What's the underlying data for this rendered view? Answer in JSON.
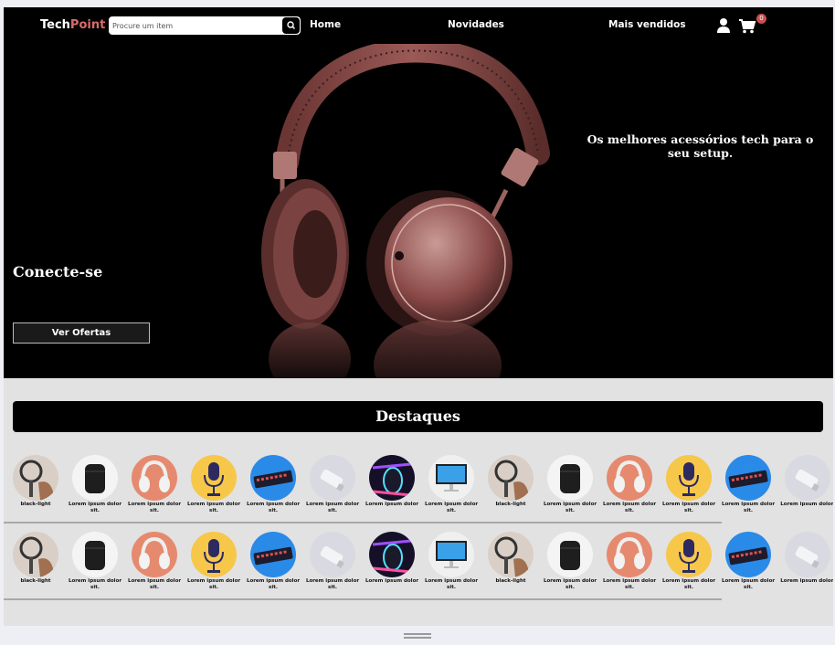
{
  "nav": {
    "logo_main": "Tech",
    "logo_accent": "Point",
    "search_placeholder": "Procure um item",
    "links": [
      "Home",
      "Novidades",
      "Mais vendidos"
    ],
    "cart_count": "0"
  },
  "hero": {
    "title": "Conecte-se",
    "tagline": "Os melhores acessórios tech para o seu setup.",
    "button": "Ver Ofertas"
  },
  "section": {
    "title": "Destaques"
  },
  "row1": [
    {
      "icon": "ring-light-icon",
      "caption": "black-light"
    },
    {
      "icon": "earbuds-case-icon",
      "caption": "Lorem ipsum dolor sit."
    },
    {
      "icon": "headphones-icon",
      "caption": "Lorem ipsum dolor sit."
    },
    {
      "icon": "microphone-icon",
      "caption": "Lorem ipsum dolor sit."
    },
    {
      "icon": "keyboard-icon",
      "caption": "Lorem ipsum dolor sit."
    },
    {
      "icon": "usb-drive-icon",
      "caption": "Lorem ipsum dolor sit."
    },
    {
      "icon": "mouse-rgb-icon",
      "caption": "Lorem ipsum dolor"
    },
    {
      "icon": "monitor-icon",
      "caption": "Lorem ipsum dolor sit."
    },
    {
      "icon": "ring-light-icon",
      "caption": "black-light"
    },
    {
      "icon": "earbuds-case-icon",
      "caption": "Lorem ipsum dolor sit."
    },
    {
      "icon": "headphones-icon",
      "caption": "Lorem ipsum dolor sit."
    },
    {
      "icon": "microphone-icon",
      "caption": "Lorem ipsum dolor sit."
    },
    {
      "icon": "keyboard-icon",
      "caption": "Lorem ipsum dolor sit."
    },
    {
      "icon": "usb-drive-icon",
      "caption": "Lorem ipsum dolor."
    }
  ],
  "row2": [
    {
      "icon": "ring-light-icon",
      "caption": "black-light"
    },
    {
      "icon": "earbuds-case-icon",
      "caption": "Lorem ipsum dolor sit."
    },
    {
      "icon": "headphones-icon",
      "caption": "Lorem ipsum dolor sit."
    },
    {
      "icon": "microphone-icon",
      "caption": "Lorem ipsum dolor sit."
    },
    {
      "icon": "keyboard-icon",
      "caption": "Lorem ipsum dolor sit."
    },
    {
      "icon": "usb-drive-icon",
      "caption": "Lorem ipsum dolor sit."
    },
    {
      "icon": "mouse-rgb-icon",
      "caption": "Lorem ipsum dolor"
    },
    {
      "icon": "monitor-icon",
      "caption": "Lorem ipsum dolor sit."
    },
    {
      "icon": "ring-light-icon",
      "caption": "black-light"
    },
    {
      "icon": "earbuds-case-icon",
      "caption": "Lorem ipsum dolor sit."
    },
    {
      "icon": "headphones-icon",
      "caption": "Lorem ipsum dolor sit."
    },
    {
      "icon": "microphone-icon",
      "caption": "Lorem ipsum dolor sit."
    },
    {
      "icon": "keyboard-icon",
      "caption": "Lorem ipsum dolor sit."
    },
    {
      "icon": "usb-drive-icon",
      "caption": "Lorem ipsum dolor."
    }
  ],
  "colors": {
    "accent": "#d96b6b",
    "badge": "#c94f4f",
    "headphone": "#8a4a48",
    "background": "#e2e2e2"
  }
}
